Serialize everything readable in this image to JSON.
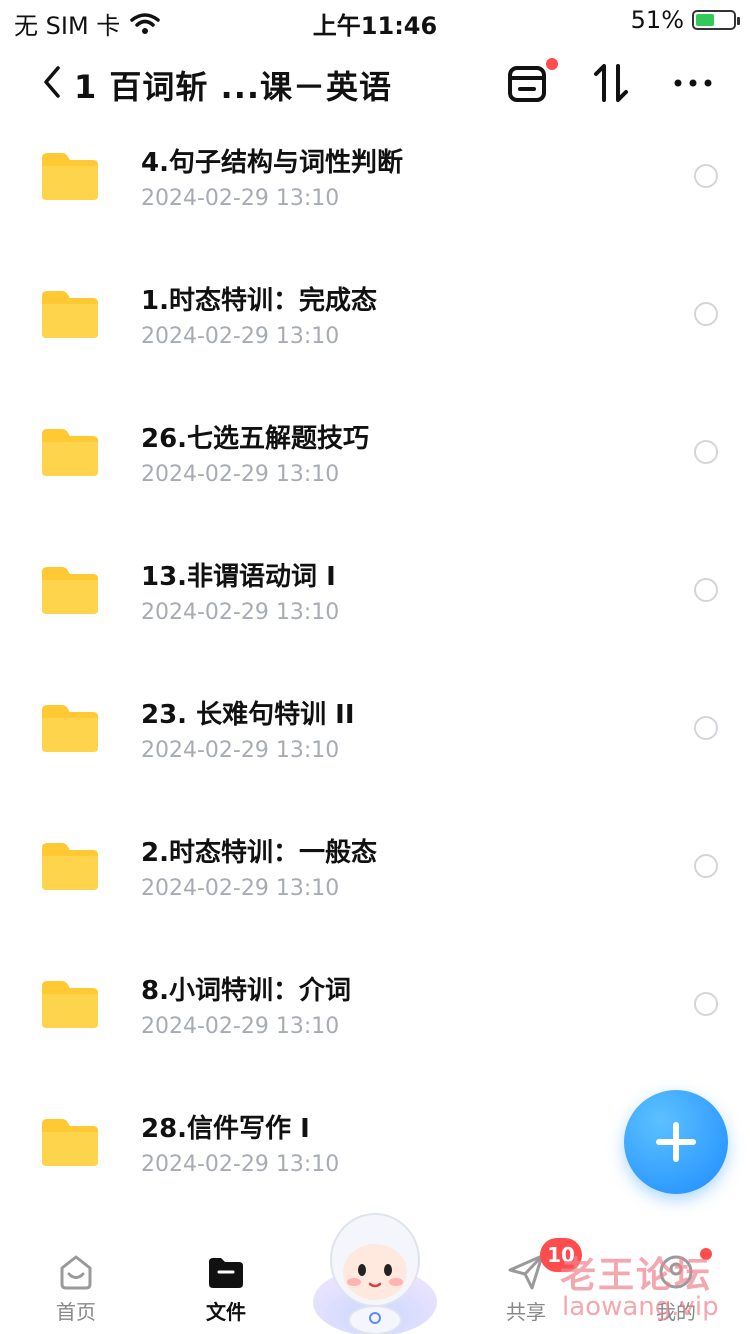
{
  "status_bar": {
    "carrier": "无 SIM 卡",
    "time": "上午11:46",
    "battery_text": "51%",
    "battery_level": 0.51
  },
  "navbar": {
    "title": "1 百词斩 ...课－英语"
  },
  "files": [
    {
      "name": "4.句子结构与词性判断",
      "date": "2024-02-29 13:10"
    },
    {
      "name": "1.时态特训：完成态",
      "date": "2024-02-29 13:10"
    },
    {
      "name": "26.七选五解题技巧",
      "date": "2024-02-29 13:10"
    },
    {
      "name": "13.非谓语动词 I",
      "date": "2024-02-29 13:10"
    },
    {
      "name": "23. 长难句特训 II",
      "date": "2024-02-29 13:10"
    },
    {
      "name": "2.时态特训：一般态",
      "date": "2024-02-29 13:10"
    },
    {
      "name": "8.小词特训：介词",
      "date": "2024-02-29 13:10"
    },
    {
      "name": "28.信件写作 I",
      "date": "2024-02-29 13:10"
    }
  ],
  "tabbar": {
    "home": "首页",
    "files": "文件",
    "share": "共享",
    "share_badge": "10",
    "mine": "我的"
  },
  "watermark": {
    "line1": "老王论坛",
    "line2": "laowang.vip"
  },
  "colors": {
    "folder": "#ffc933",
    "accent": "#1e8cff",
    "badge": "#ff4d4f",
    "battery": "#34c759"
  }
}
